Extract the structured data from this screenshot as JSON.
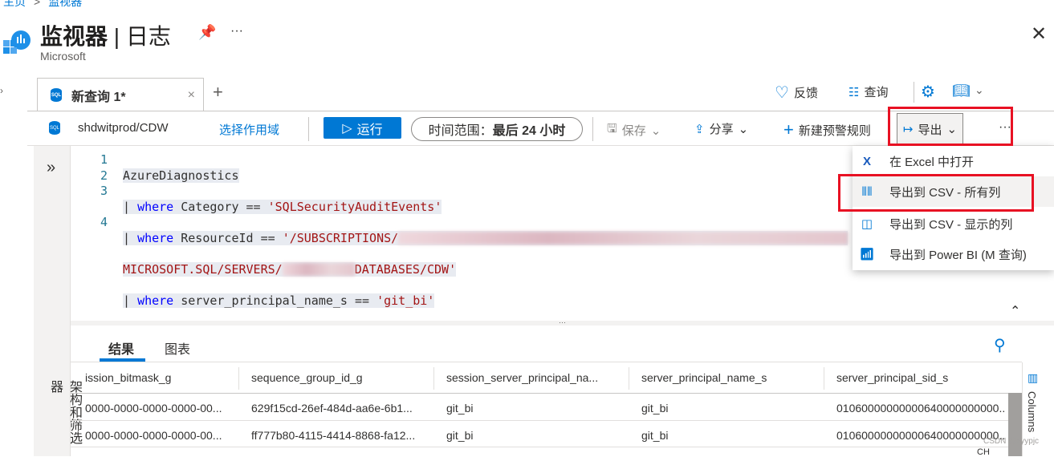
{
  "breadcrumb": [
    "主页",
    ">",
    "监视器"
  ],
  "header": {
    "title": "监视器",
    "separator": "|",
    "subtitle_page": "日志",
    "publisher": "Microsoft",
    "more": "···",
    "close": "✕"
  },
  "query_tab": {
    "label": "新查询 1*",
    "close": "×",
    "add": "+"
  },
  "top_actions": {
    "feedback": "反馈",
    "queries": "查询"
  },
  "toolbar": {
    "scope": "shdwitprod/CDW",
    "select_scope": "选择作用域",
    "run": "运行",
    "time_range_label": "时间范围：",
    "time_range_value": "最后 24 小时",
    "save": "保存",
    "share": "分享",
    "new_alert": "新建预警规则",
    "export": "导出",
    "more": "···"
  },
  "editor": {
    "line_numbers": [
      "1",
      "2",
      "3",
      "",
      "4"
    ],
    "lines": {
      "l1": "AzureDiagnostics",
      "l2_pipe": "| ",
      "l2_kw": "where",
      "l2_mid": " Category == ",
      "l2_str": "'SQLSecurityAuditEvents'",
      "l3_pipe": "| ",
      "l3_kw": "where",
      "l3_mid": " ResourceId == ",
      "l3_str": "'/SUBSCRIPTIONS/",
      "l3b_a": "MICROSOFT.SQL/SERVERS/",
      "l3b_b": "DATABASES/CDW'",
      "l4_pipe": "| ",
      "l4_kw": "where",
      "l4_mid": " server_principal_name_s == ",
      "l4_str": "'git_bi'"
    }
  },
  "left_panel": {
    "label": "架构和筛选器",
    "expand": "»"
  },
  "export_menu": [
    {
      "label": "在 Excel 中打开",
      "icon": "excel-icon"
    },
    {
      "label": "导出到 CSV - 所有列",
      "icon": "csv-all-icon"
    },
    {
      "label": "导出到 CSV - 显示的列",
      "icon": "csv-displayed-icon"
    },
    {
      "label": "导出到 Power BI (M 查询)",
      "icon": "powerbi-icon"
    }
  ],
  "results": {
    "tabs": [
      "结果",
      "图表"
    ],
    "columns": [
      "ission_bitmask_g",
      "sequence_group_id_g",
      "session_server_principal_na...",
      "server_principal_name_s",
      "server_principal_sid_s"
    ],
    "rows": [
      [
        "0000-0000-0000-0000-00...",
        "629f15cd-26ef-484d-aa6e-6b1...",
        "git_bi",
        "git_bi",
        "01060000000000640000000000..."
      ],
      [
        "0000-0000-0000-0000-00...",
        "ff777b80-4115-4414-8868-fa12...",
        "git_bi",
        "git_bi",
        "01060000000000640000000000..."
      ]
    ],
    "columns_panel": "Columns"
  },
  "watermark": "CSDN @zyypjc",
  "ime": "CH",
  "colors": {
    "accent": "#0078d4",
    "highlight": "#e81123"
  }
}
